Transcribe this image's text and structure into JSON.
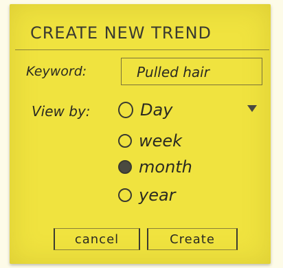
{
  "dialog": {
    "title": "CREATE NEW TREND",
    "keyword_label": "Keyword:",
    "keyword_value": "Pulled hair",
    "viewby_label": "View by:",
    "options": [
      {
        "label": "Day",
        "selected": false
      },
      {
        "label": "week",
        "selected": false
      },
      {
        "label": "month",
        "selected": true
      },
      {
        "label": "year",
        "selected": false
      }
    ],
    "cancel_label": "cancel",
    "create_label": "Create"
  }
}
